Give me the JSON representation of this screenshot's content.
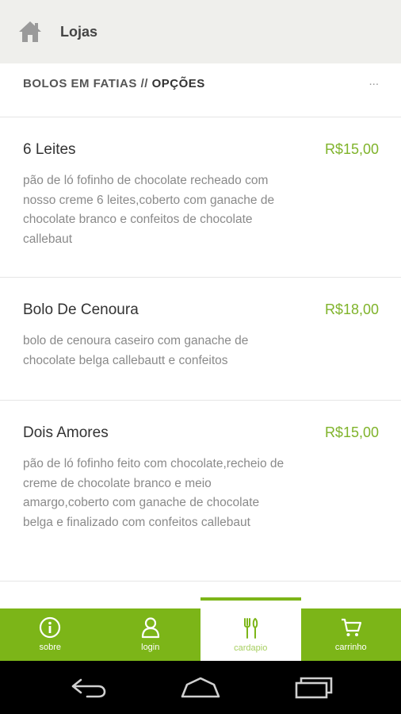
{
  "header": {
    "title": "Lojas",
    "home_icon": "home-icon"
  },
  "section": {
    "category": "BOLOS EM FATIAS",
    "separator": "//",
    "options": "OPÇÕES",
    "menu": "..."
  },
  "products": [
    {
      "name": "6 Leites",
      "price": "R$15,00",
      "description": "pão de ló fofinho de chocolate recheado com nosso creme 6 leites,coberto com ganache de chocolate branco e confeitos de chocolate callebaut"
    },
    {
      "name": "Bolo De Cenoura",
      "price": "R$18,00",
      "description": "bolo de cenoura caseiro com ganache de chocolate belga callebautt e confeitos"
    },
    {
      "name": "Dois Amores",
      "price": "R$15,00",
      "description": "pão de ló fofinho feito com chocolate,recheio de creme de chocolate branco e meio amargo,coberto com ganache de chocolate belga e finalizado com confeitos callebaut"
    }
  ],
  "tabs": [
    {
      "label": "sobre",
      "icon": "info-icon",
      "active": false
    },
    {
      "label": "login",
      "icon": "user-icon",
      "active": false
    },
    {
      "label": "cardapio",
      "icon": "cutlery-icon",
      "active": true
    },
    {
      "label": "carrinho",
      "icon": "cart-icon",
      "active": false
    }
  ],
  "colors": {
    "accent": "#7cb518",
    "price": "#7fb32a",
    "header_bg": "#efefec"
  }
}
